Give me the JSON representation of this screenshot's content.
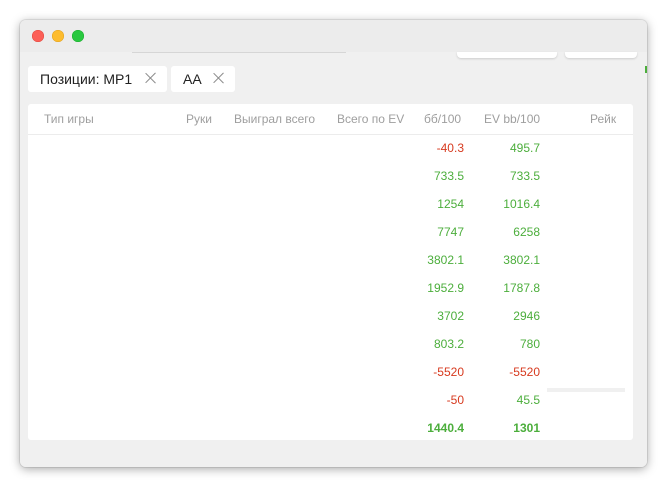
{
  "tabs": [
    {
      "label": "Позиции: MP1"
    },
    {
      "label": "AA"
    }
  ],
  "table": {
    "columns": [
      "Тип игры",
      "Руки",
      "Выиграл всего",
      "Всего по EV",
      "бб/100",
      "EV bb/100",
      "Рейк"
    ],
    "rows": [
      {
        "bb100": "-40.3",
        "ev_bb100": "495.7",
        "bb_sign": "neg",
        "ev_sign": "pos"
      },
      {
        "bb100": "733.5",
        "ev_bb100": "733.5",
        "bb_sign": "pos",
        "ev_sign": "pos"
      },
      {
        "bb100": "1254",
        "ev_bb100": "1016.4",
        "bb_sign": "pos",
        "ev_sign": "pos"
      },
      {
        "bb100": "7747",
        "ev_bb100": "6258",
        "bb_sign": "pos",
        "ev_sign": "pos"
      },
      {
        "bb100": "3802.1",
        "ev_bb100": "3802.1",
        "bb_sign": "pos",
        "ev_sign": "pos"
      },
      {
        "bb100": "1952.9",
        "ev_bb100": "1787.8",
        "bb_sign": "pos",
        "ev_sign": "pos"
      },
      {
        "bb100": "3702",
        "ev_bb100": "2946",
        "bb_sign": "pos",
        "ev_sign": "pos"
      },
      {
        "bb100": "803.2",
        "ev_bb100": "780",
        "bb_sign": "pos",
        "ev_sign": "pos"
      },
      {
        "bb100": "-5520",
        "ev_bb100": "-5520",
        "bb_sign": "neg",
        "ev_sign": "neg"
      },
      {
        "bb100": "-50",
        "ev_bb100": "45.5",
        "bb_sign": "neg",
        "ev_sign": "pos"
      }
    ],
    "total": {
      "bb100": "1440.4",
      "ev_bb100": "1301"
    }
  },
  "colors": {
    "positive": "#4cae3c",
    "negative": "#d73a1f"
  }
}
